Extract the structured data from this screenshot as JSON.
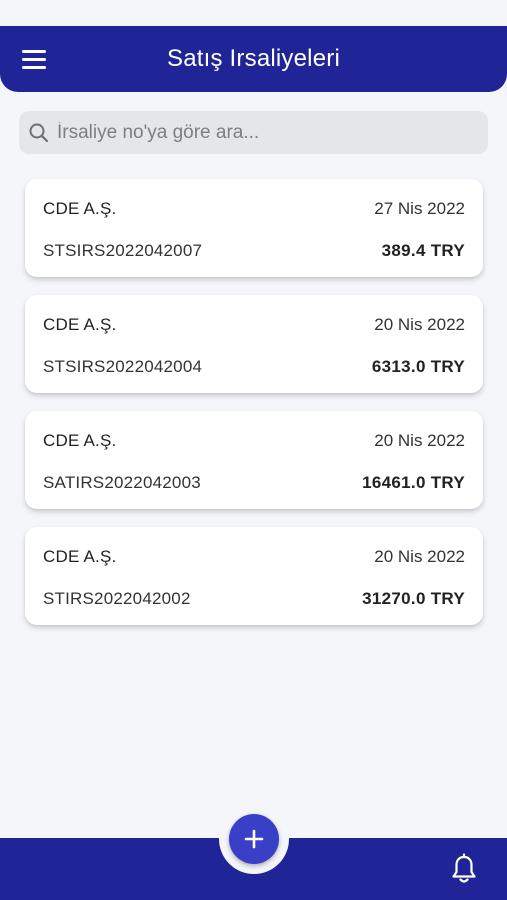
{
  "header": {
    "title": "Satış Irsaliyeleri"
  },
  "search": {
    "placeholder": "İrsaliye no'ya göre ara..."
  },
  "cards": [
    {
      "company": "CDE A.Ş.",
      "date": "27 Nis 2022",
      "doc_no": "STSIRS2022042007",
      "amount": "389.4 TRY"
    },
    {
      "company": "CDE A.Ş.",
      "date": "20 Nis 2022",
      "doc_no": "STSIRS2022042004",
      "amount": "6313.0 TRY"
    },
    {
      "company": "CDE A.Ş.",
      "date": "20 Nis 2022",
      "doc_no": "SATIRS2022042003",
      "amount": "16461.0 TRY"
    },
    {
      "company": "CDE A.Ş.",
      "date": "20 Nis 2022",
      "doc_no": "STIRS2022042002",
      "amount": "31270.0 TRY"
    }
  ],
  "icons": {
    "menu": "hamburger-menu-icon",
    "search": "search-icon",
    "add": "plus-icon",
    "notifications": "bell-icon"
  },
  "colors": {
    "primary": "#1f2596",
    "fab": "#3a3fc7",
    "background": "#f5f6fa"
  }
}
